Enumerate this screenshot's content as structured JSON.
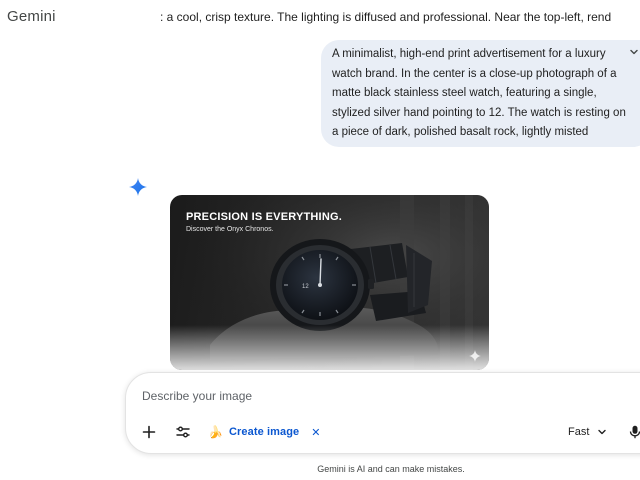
{
  "header": {
    "brand": "Gemini",
    "prompt_ticker": ": a cool, crisp texture. The lighting is diffused and professional. Near the top-left, rend"
  },
  "user_message": {
    "text": "A minimalist, high-end print advertisement for a luxury watch brand. In the center is a close-up photograph of a matte black stainless steel watch, featuring a single, stylized silver hand pointing to 12. The watch is resting on a piece of dark, polished basalt rock, lightly misted",
    "expand_icon": "chevron-down-icon"
  },
  "response": {
    "avatar_icon": "gemini-spark-icon",
    "generated_image": {
      "headline": "PRECISION IS EVERYTHING.",
      "subheadline": "Discover the Onyx Chronos.",
      "dial_numeral": "12",
      "watermark_icon": "sparkle-watermark-icon"
    }
  },
  "composer": {
    "placeholder": "Describe your image",
    "value": "",
    "add_icon": "plus-icon",
    "tools_icon": "tools-sliders-icon",
    "tool_chip": {
      "emoji": "🍌",
      "label": "Create image",
      "close_symbol": "✕"
    },
    "mode": {
      "selected": "Fast",
      "icon": "chevron-down-icon"
    },
    "mic_icon": "microphone-icon"
  },
  "footer": {
    "disclaimer": "Gemini is AI and can make mistakes."
  },
  "colors": {
    "user_bubble": "#e9eef6",
    "accent_blue": "#0b57d0",
    "spark_blue": "#4285f4"
  }
}
